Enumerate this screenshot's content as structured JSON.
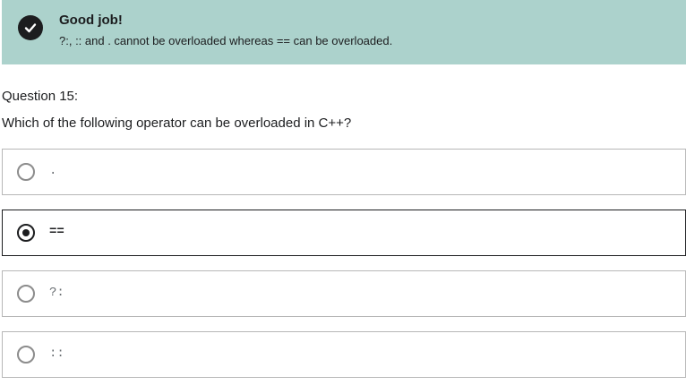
{
  "feedback": {
    "status": "success",
    "icon": "check-circle-icon",
    "title": "Good job!",
    "explanation": "?:, :: and . cannot be overloaded whereas == can be overloaded.",
    "background_color": "#acd2cc"
  },
  "question": {
    "number_label": "Question 15:",
    "prompt": "Which of the following operator can be overloaded in C++?"
  },
  "options": [
    {
      "label": ".",
      "selected": false
    },
    {
      "label": "==",
      "selected": true
    },
    {
      "label": "?:",
      "selected": false
    },
    {
      "label": "::",
      "selected": false
    }
  ]
}
